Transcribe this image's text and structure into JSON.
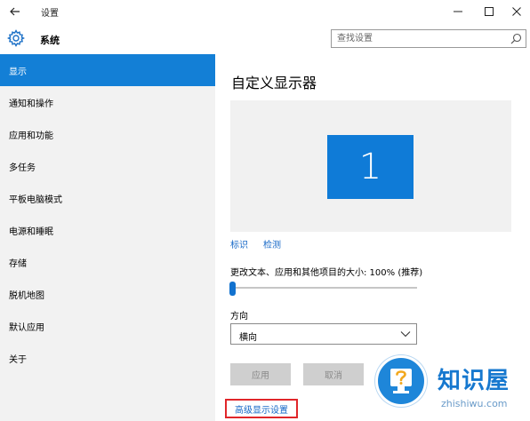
{
  "window": {
    "title": "设置",
    "minimize_glyph": "—",
    "maximize_glyph": "☐",
    "close_glyph": "✕"
  },
  "header": {
    "title": "系统",
    "search_placeholder": "查找设置"
  },
  "sidebar": {
    "items": [
      {
        "label": "显示",
        "active": true
      },
      {
        "label": "通知和操作",
        "active": false
      },
      {
        "label": "应用和功能",
        "active": false
      },
      {
        "label": "多任务",
        "active": false
      },
      {
        "label": "平板电脑模式",
        "active": false
      },
      {
        "label": "电源和睡眠",
        "active": false
      },
      {
        "label": "存储",
        "active": false
      },
      {
        "label": "脱机地图",
        "active": false
      },
      {
        "label": "默认应用",
        "active": false
      },
      {
        "label": "关于",
        "active": false
      }
    ]
  },
  "main": {
    "title": "自定义显示器",
    "monitor_number": "1",
    "identify_link": "标识",
    "detect_link": "检测",
    "scale_label": "更改文本、应用和其他项目的大小: 100% (推荐)",
    "scale_value": 0,
    "orientation_label": "方向",
    "orientation_value": "横向",
    "apply_button": "应用",
    "cancel_button": "取消",
    "advanced_link": "高级显示设置"
  },
  "watermark": {
    "text": "知识屋",
    "sub": "zhishiwu.com"
  },
  "colors": {
    "accent": "#137fd6",
    "sidebar_bg": "#f2f2f2",
    "link": "#1668c7",
    "highlight_border": "#e0262a"
  }
}
